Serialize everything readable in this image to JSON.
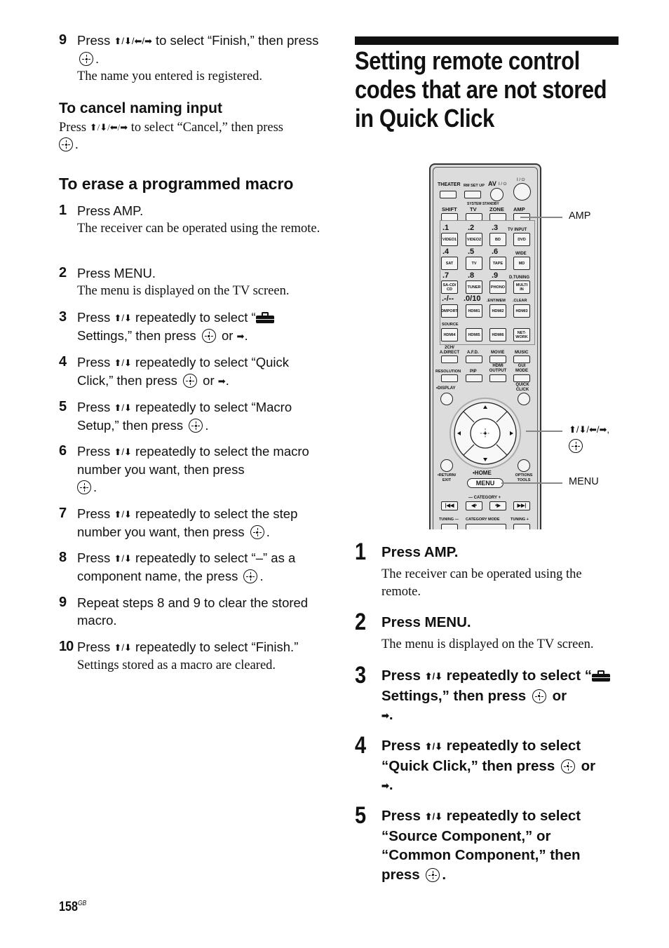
{
  "left_column": {
    "step9_top": {
      "number": "9",
      "text_a": "Press ",
      "arrows": "⬆/⬇/⬅/➡",
      "text_b": " to select “Finish,” then press ",
      "text_c": ".",
      "note": "The name you entered is registered."
    },
    "cancel_section": {
      "heading": "To cancel naming input",
      "text_a": "Press ",
      "arrows": "⬆/⬇/⬅/➡",
      "text_b": " to select “Cancel,” then press",
      "text_c": "."
    },
    "erase_section": {
      "heading": "To erase a programmed macro",
      "steps": [
        {
          "number": "1",
          "text": "Press AMP.",
          "note": "The receiver can be operated using the remote."
        },
        {
          "number": "2",
          "text": "Press MENU.",
          "note": "The menu is displayed on the TV screen."
        },
        {
          "number": "3",
          "text_a": "Press ",
          "arrows": "⬆/⬇",
          "text_b": " repeatedly to select “",
          "text_c": "Settings,” then press ",
          "text_d": " or ",
          "arrow_right": "➡",
          "text_e": "."
        },
        {
          "number": "4",
          "text_a": "Press ",
          "arrows": "⬆/⬇",
          "text_b": " repeatedly to select “Quick Click,” then press ",
          "text_d": " or ",
          "arrow_right": "➡",
          "text_e": "."
        },
        {
          "number": "5",
          "text_a": "Press ",
          "arrows": "⬆/⬇",
          "text_b": " repeatedly to select “Macro Setup,” then press ",
          "text_e": "."
        },
        {
          "number": "6",
          "text_a": "Press ",
          "arrows": "⬆/⬇",
          "text_b": " repeatedly to select the macro number you want, then press",
          "text_e": "."
        },
        {
          "number": "7",
          "text_a": "Press ",
          "arrows": "⬆/⬇",
          "text_b": " repeatedly to select the step number you want, then press ",
          "text_e": "."
        },
        {
          "number": "8",
          "text_a": "Press ",
          "arrows": "⬆/⬇",
          "text_b": " repeatedly to select “–” as a component name, the press ",
          "text_e": "."
        },
        {
          "number": "9",
          "text": "Repeat steps 8 and 9 to clear the stored macro."
        },
        {
          "number": "10",
          "text_a": "Press ",
          "arrows": "⬆/⬇",
          "text_b": " repeatedly to select “Finish.”",
          "note": "Settings stored as a macro are cleared."
        }
      ]
    }
  },
  "right_column": {
    "title": [
      "Setting remote control",
      "codes that are not stored",
      "in Quick Click"
    ],
    "illustration": {
      "callouts": {
        "amp": "AMP",
        "arrows": "⬆/⬇/⬅/➡,",
        "menu": "MENU"
      },
      "remote_labels": {
        "theater": "THEATER",
        "rm_setup": "RM SET UP",
        "av": "AV",
        "av_power": "I / ⏻",
        "power": "I / ⏻",
        "system_standby": "SYSTEM STANDBY",
        "shift": "SHIFT",
        "tv": "TV",
        "zone": "ZONE",
        "amp": "AMP",
        "n1": ".1",
        "n2": ".2",
        "n3": ".3",
        "tv_input": "TV INPUT",
        "video1": "VIDEO1",
        "video2": "VIDEO2",
        "bd": "BD",
        "dvd": "DVD",
        "n4": ".4",
        "n5": ".5",
        "n6": ".6",
        "wide": "WIDE",
        "sat": "SAT",
        "tv_btn": "TV",
        "tape": "TAPE",
        "md": "MD",
        "n7": ".7",
        "n8": ".8",
        "n9": ".9",
        "dtuning": "D.TUNING",
        "sacd": "SA-CD/ CD",
        "tuner": "TUNER",
        "phono": "PHONO",
        "multi_in": "MULTI IN",
        "dash": ".-/--",
        "n0": ".0/10",
        "ent_mem": ".ENT/MEM",
        "clear": ".CLEAR",
        "comport": "DMPORT",
        "hdmi1": "HDMI1",
        "hdmi2": "HDMI2",
        "hdmi3": "HDMI3",
        "source": "SOURCE",
        "hdmi4": "HDMI4",
        "hdmi5": "HDMI5",
        "hdmi6": "HDMI6",
        "network": "NET- WORK",
        "two_ch": "2CH/ A.DIRECT",
        "afd": "A.F.D.",
        "movie": "MOVIE",
        "music": "MUSIC",
        "resolution": "RESOLUTION",
        "pip": "PIP",
        "hdmi_output": "HDMI OUTPUT",
        "gui_mode": "GUI MODE",
        "display": "•DISPLAY",
        "quick_click": "QUICK CLICK",
        "return_exit": "•RETURN/ EXIT",
        "home": "•HOME",
        "options_tools": "OPTIONS TOOLS",
        "menu": "MENU",
        "category": "— CATEGORY +",
        "tuning_minus": "TUNING —",
        "category_mode": "CATEGORY MODE",
        "tuning_plus": "TUNING +"
      }
    },
    "steps": [
      {
        "number": "1",
        "text": "Press AMP.",
        "note": "The receiver can be operated using the remote."
      },
      {
        "number": "2",
        "text": "Press MENU.",
        "note": "The menu is displayed on the TV screen."
      },
      {
        "number": "3",
        "text_a": "Press ",
        "arrows": "⬆/⬇",
        "text_b": " repeatedly to select “",
        "text_c": "Settings,” then press ",
        "text_d": " or ",
        "arrow_right": "➡",
        "text_e": "."
      },
      {
        "number": "4",
        "text_a": "Press ",
        "arrows": "⬆/⬇",
        "text_b": " repeatedly to select “Quick Click,” then press ",
        "text_d": " or ",
        "arrow_right": "➡",
        "text_e": "."
      },
      {
        "number": "5",
        "text_a": "Press ",
        "arrows": "⬆/⬇",
        "text_b": " repeatedly to select “Source Component,” or “Common Component,” then press ",
        "text_e": "."
      }
    ]
  },
  "footer": {
    "page_number": "158",
    "page_suffix": "GB"
  }
}
